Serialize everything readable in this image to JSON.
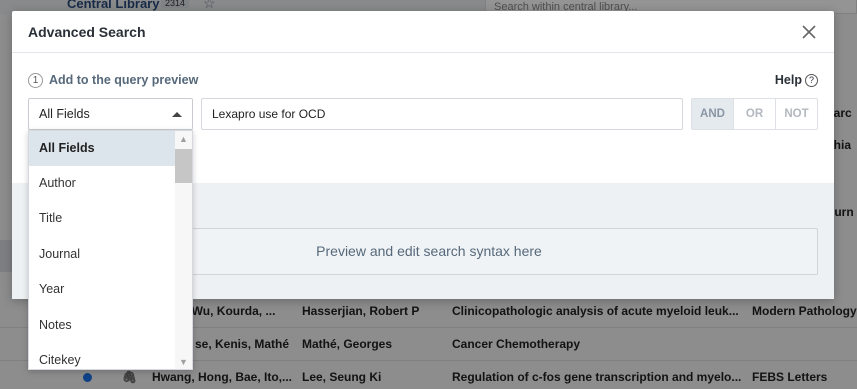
{
  "background": {
    "library_name": "Central Library",
    "library_count": "2314",
    "search_placeholder": "Search within central library...",
    "side_fragments": [
      "earc",
      "chia",
      "ourn"
    ],
    "rows": [
      {
        "authors": "le, Wu, Kourda, ...",
        "editor": "Hasserjian, Robert P",
        "title": "Clinicopathologic analysis of acute myeloid leuk...",
        "journal": "Modern Pathology"
      },
      {
        "authors": "se, Kenis, Mathé",
        "editor": "Mathé, Georges",
        "title": "Cancer Chemotherapy",
        "journal": ""
      },
      {
        "authors": "Hwang, Hong, Bae, Ito,...",
        "editor": "Lee, Seung Ki",
        "title": "Regulation of c-fos gene transcription and myelo...",
        "journal": "FEBS Letters"
      }
    ]
  },
  "modal": {
    "title": "Advanced Search",
    "step_number": "1",
    "step_label": "Add to the query preview",
    "help_label": "Help",
    "help_icon": "?",
    "field_select_value": "All Fields",
    "query_value": "Lexapro use for OCD",
    "bool_buttons": [
      "AND",
      "OR",
      "NOT"
    ],
    "preview_placeholder": "Preview and edit search syntax here",
    "dropdown_options": [
      "All Fields",
      "Author",
      "Title",
      "Journal",
      "Year",
      "Notes",
      "Citekey"
    ]
  },
  "colors": {
    "accent": "#2a4b7c",
    "selected_option_bg": "#dde5ec",
    "preview_text": "#56697b"
  }
}
